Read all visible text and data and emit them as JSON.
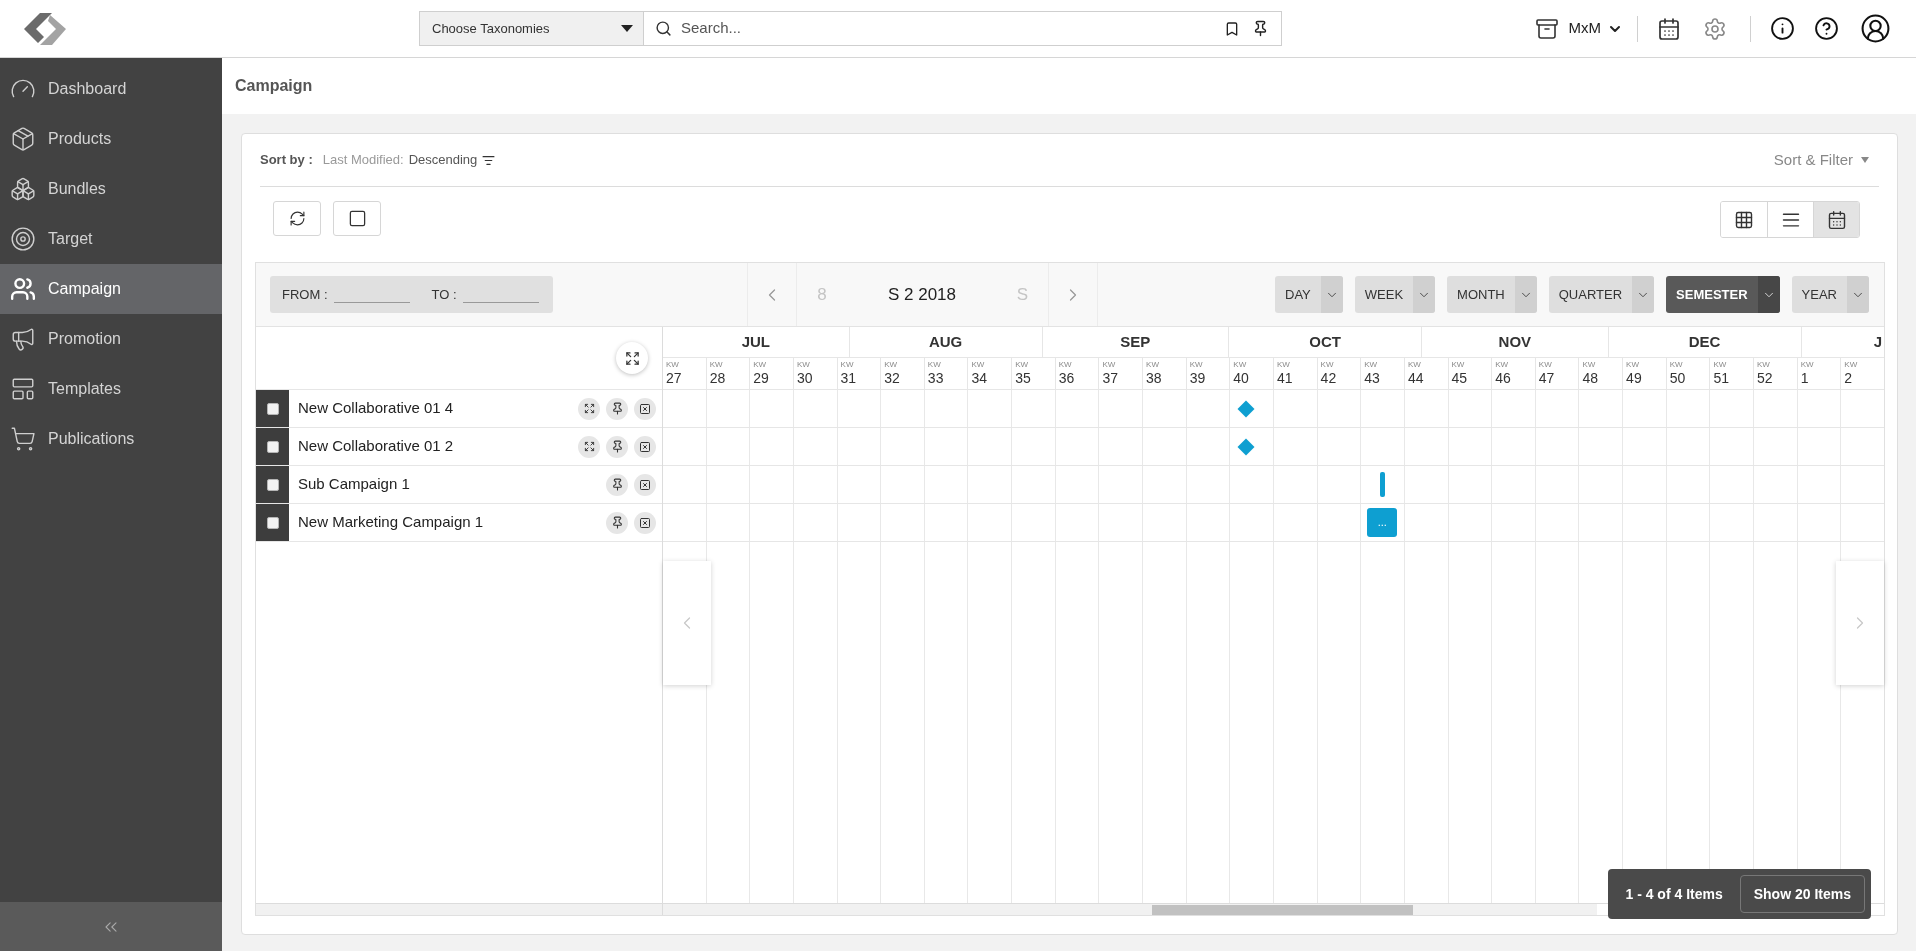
{
  "top_bar": {
    "taxonomy_select": {
      "label": "Choose Taxonomies"
    },
    "search": {
      "placeholder": "Search..."
    },
    "workspace": {
      "label": "MxM"
    }
  },
  "sidebar": {
    "items": [
      {
        "label": "Dashboard",
        "selected": false
      },
      {
        "label": "Products",
        "selected": false
      },
      {
        "label": "Bundles",
        "selected": false
      },
      {
        "label": "Target",
        "selected": false
      },
      {
        "label": "Campaign",
        "selected": true
      },
      {
        "label": "Promotion",
        "selected": false
      },
      {
        "label": "Templates",
        "selected": false
      },
      {
        "label": "Publications",
        "selected": false
      }
    ]
  },
  "page": {
    "title": "Campaign"
  },
  "sort": {
    "label": "Sort by :",
    "field": "Last Modified:",
    "order": "Descending"
  },
  "sort_filter": {
    "label": "Sort & Filter"
  },
  "view_modes": [
    {
      "kind": "grid",
      "selected": false
    },
    {
      "kind": "list",
      "selected": false
    },
    {
      "kind": "calendar",
      "selected": true
    }
  ],
  "gantt": {
    "from": {
      "label": "FROM :"
    },
    "to": {
      "label": "TO :"
    },
    "period": {
      "previous": "8",
      "current": "S 2 2018",
      "next": "S"
    },
    "scales": [
      {
        "label": "DAY",
        "selected": false
      },
      {
        "label": "WEEK",
        "selected": false
      },
      {
        "label": "MONTH",
        "selected": false
      },
      {
        "label": "QUARTER",
        "selected": false
      },
      {
        "label": "SEMESTER",
        "selected": true
      },
      {
        "label": "YEAR",
        "selected": false
      }
    ],
    "months": [
      "JUL",
      "AUG",
      "SEP",
      "OCT",
      "NOV",
      "DEC",
      "J"
    ],
    "weeks": [
      {
        "unit": "KW",
        "number": "27"
      },
      {
        "unit": "KW",
        "number": "28"
      },
      {
        "unit": "KW",
        "number": "29"
      },
      {
        "unit": "KW",
        "number": "30"
      },
      {
        "unit": "KW",
        "number": "31"
      },
      {
        "unit": "KW",
        "number": "32"
      },
      {
        "unit": "KW",
        "number": "33"
      },
      {
        "unit": "KW",
        "number": "34"
      },
      {
        "unit": "KW",
        "number": "35"
      },
      {
        "unit": "KW",
        "number": "36"
      },
      {
        "unit": "KW",
        "number": "37"
      },
      {
        "unit": "KW",
        "number": "38"
      },
      {
        "unit": "KW",
        "number": "39"
      },
      {
        "unit": "KW",
        "number": "40"
      },
      {
        "unit": "KW",
        "number": "41"
      },
      {
        "unit": "KW",
        "number": "42"
      },
      {
        "unit": "KW",
        "number": "43"
      },
      {
        "unit": "KW",
        "number": "44"
      },
      {
        "unit": "KW",
        "number": "45"
      },
      {
        "unit": "KW",
        "number": "46"
      },
      {
        "unit": "KW",
        "number": "47"
      },
      {
        "unit": "KW",
        "number": "48"
      },
      {
        "unit": "KW",
        "number": "49"
      },
      {
        "unit": "KW",
        "number": "50"
      },
      {
        "unit": "KW",
        "number": "51"
      },
      {
        "unit": "KW",
        "number": "52"
      },
      {
        "unit": "KW",
        "number": "1"
      },
      {
        "unit": "KW",
        "number": "2"
      }
    ],
    "rows": [
      {
        "name": "New Collaborative 01 4",
        "checked": false,
        "expandable": true,
        "timeline": [
          {
            "kind": "empty"
          },
          {
            "kind": "empty"
          },
          {
            "kind": "empty"
          },
          {
            "kind": "empty"
          },
          {
            "kind": "empty"
          },
          {
            "kind": "empty"
          },
          {
            "kind": "empty"
          },
          {
            "kind": "empty"
          },
          {
            "kind": "empty"
          },
          {
            "kind": "empty"
          },
          {
            "kind": "empty"
          },
          {
            "kind": "empty"
          },
          {
            "kind": "empty"
          },
          {
            "kind": "milestone"
          },
          {
            "kind": "empty"
          },
          {
            "kind": "empty"
          },
          {
            "kind": "empty"
          },
          {
            "kind": "empty"
          },
          {
            "kind": "empty"
          },
          {
            "kind": "empty"
          },
          {
            "kind": "empty"
          },
          {
            "kind": "empty"
          },
          {
            "kind": "empty"
          },
          {
            "kind": "empty"
          },
          {
            "kind": "empty"
          },
          {
            "kind": "empty"
          },
          {
            "kind": "empty"
          },
          {
            "kind": "empty"
          }
        ]
      },
      {
        "name": "New Collaborative 01 2",
        "checked": false,
        "expandable": true,
        "timeline": [
          {
            "kind": "empty"
          },
          {
            "kind": "empty"
          },
          {
            "kind": "empty"
          },
          {
            "kind": "empty"
          },
          {
            "kind": "empty"
          },
          {
            "kind": "empty"
          },
          {
            "kind": "empty"
          },
          {
            "kind": "empty"
          },
          {
            "kind": "empty"
          },
          {
            "kind": "empty"
          },
          {
            "kind": "empty"
          },
          {
            "kind": "empty"
          },
          {
            "kind": "empty"
          },
          {
            "kind": "milestone"
          },
          {
            "kind": "empty"
          },
          {
            "kind": "empty"
          },
          {
            "kind": "empty"
          },
          {
            "kind": "empty"
          },
          {
            "kind": "empty"
          },
          {
            "kind": "empty"
          },
          {
            "kind": "empty"
          },
          {
            "kind": "empty"
          },
          {
            "kind": "empty"
          },
          {
            "kind": "empty"
          },
          {
            "kind": "empty"
          },
          {
            "kind": "empty"
          },
          {
            "kind": "empty"
          },
          {
            "kind": "empty"
          }
        ]
      },
      {
        "name": "Sub Campaign 1",
        "checked": false,
        "expandable": false,
        "timeline": [
          {
            "kind": "empty"
          },
          {
            "kind": "empty"
          },
          {
            "kind": "empty"
          },
          {
            "kind": "empty"
          },
          {
            "kind": "empty"
          },
          {
            "kind": "empty"
          },
          {
            "kind": "empty"
          },
          {
            "kind": "empty"
          },
          {
            "kind": "empty"
          },
          {
            "kind": "empty"
          },
          {
            "kind": "empty"
          },
          {
            "kind": "empty"
          },
          {
            "kind": "empty"
          },
          {
            "kind": "empty"
          },
          {
            "kind": "empty"
          },
          {
            "kind": "empty"
          },
          {
            "kind": "bar"
          },
          {
            "kind": "empty"
          },
          {
            "kind": "empty"
          },
          {
            "kind": "empty"
          },
          {
            "kind": "empty"
          },
          {
            "kind": "empty"
          },
          {
            "kind": "empty"
          },
          {
            "kind": "empty"
          },
          {
            "kind": "empty"
          },
          {
            "kind": "empty"
          },
          {
            "kind": "empty"
          },
          {
            "kind": "empty"
          }
        ]
      },
      {
        "name": "New Marketing Campaign 1",
        "checked": false,
        "expandable": false,
        "timeline": [
          {
            "kind": "empty"
          },
          {
            "kind": "empty"
          },
          {
            "kind": "empty"
          },
          {
            "kind": "empty"
          },
          {
            "kind": "empty"
          },
          {
            "kind": "empty"
          },
          {
            "kind": "empty"
          },
          {
            "kind": "empty"
          },
          {
            "kind": "empty"
          },
          {
            "kind": "empty"
          },
          {
            "kind": "empty"
          },
          {
            "kind": "empty"
          },
          {
            "kind": "empty"
          },
          {
            "kind": "empty"
          },
          {
            "kind": "empty"
          },
          {
            "kind": "empty"
          },
          {
            "kind": "box",
            "label": "..."
          },
          {
            "kind": "empty"
          },
          {
            "kind": "empty"
          },
          {
            "kind": "empty"
          },
          {
            "kind": "empty"
          },
          {
            "kind": "empty"
          },
          {
            "kind": "empty"
          },
          {
            "kind": "empty"
          },
          {
            "kind": "empty"
          },
          {
            "kind": "empty"
          },
          {
            "kind": "empty"
          },
          {
            "kind": "empty"
          }
        ]
      }
    ]
  },
  "pagination": {
    "summary": "1 - 4 of 4 Items",
    "page_size_button": "Show 20 Items"
  }
}
